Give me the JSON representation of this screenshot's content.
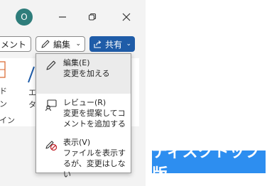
{
  "window": {
    "avatar_initial": "O"
  },
  "toolbar": {
    "comments_label": "コメント",
    "edit_label": "編集",
    "share_label": "共有"
  },
  "ribbon_fragments": {
    "frag1": "ド",
    "frag2": "ン",
    "frag3": "イン",
    "frag4": "エ",
    "frag5": "タ"
  },
  "menu": {
    "items": [
      {
        "title": "編集(E)",
        "desc": "変更を加える",
        "icon": "pencil-icon"
      },
      {
        "title": "レビュー(R)",
        "desc": "変更を提案してコメントを追加する",
        "icon": "review-icon"
      },
      {
        "title": "表示(V)",
        "desc": "ファイルを表示するが、変更はしない",
        "icon": "view-only-icon"
      }
    ]
  },
  "caption": "ディスクトップ版",
  "colors": {
    "share_bg": "#1f5ca8",
    "avatar_bg": "#2e7d7b",
    "caption_bg": "#2d8ef0"
  }
}
